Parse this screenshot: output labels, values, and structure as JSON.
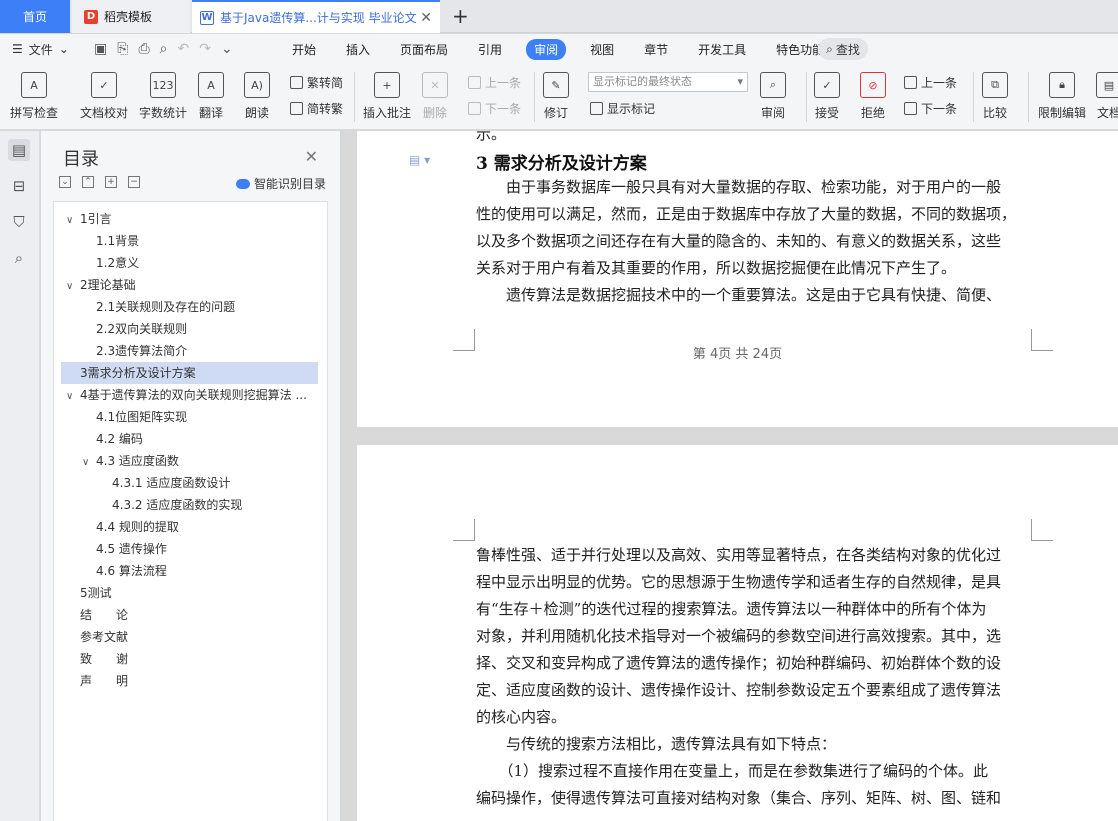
{
  "tabs": {
    "home": "首页",
    "template": "稻壳模板",
    "doc": "基于Java遗传算...计与实现 毕业论文"
  },
  "menu": {
    "file": "文件",
    "items": [
      "开始",
      "插入",
      "页面布局",
      "引用",
      "审阅",
      "视图",
      "章节",
      "开发工具",
      "特色功能"
    ],
    "active": "审阅",
    "find": "查找"
  },
  "ribbon": {
    "spellcheck": "拼写检查",
    "doc_proof": "文档校对",
    "word_count": "字数统计",
    "translate": "翻译",
    "read_aloud": "朗读",
    "to_traditional": "繁转简",
    "to_simplified": "简转繁",
    "insert_comment": "插入批注",
    "delete": "删除",
    "prev": "上一条",
    "next": "下一条",
    "revise": "修订",
    "markup_select": "显示标记的最终状态",
    "show_markup": "显示标记",
    "review": "审阅",
    "accept": "接受",
    "reject": "拒绝",
    "prev2": "上一条",
    "next2": "下一条",
    "compare": "比较",
    "restrict_edit": "限制编辑",
    "doc_right": "文档"
  },
  "toc": {
    "title": "目录",
    "smart": "智能识别目录",
    "items": [
      {
        "label": "1引言",
        "chev": "∨"
      },
      {
        "label": "1.1背景",
        "chev": ""
      },
      {
        "label": "1.2意义",
        "chev": ""
      },
      {
        "label": "2理论基础",
        "chev": "∨"
      },
      {
        "label": "2.1关联规则及存在的问题",
        "chev": ""
      },
      {
        "label": "2.2双向关联规则",
        "chev": ""
      },
      {
        "label": "2.3遗传算法简介",
        "chev": ""
      },
      {
        "label": "3需求分析及设计方案",
        "chev": ""
      },
      {
        "label": "4基于遗传算法的双向关联规则挖掘算法 ...",
        "chev": "∨"
      },
      {
        "label": "4.1位图矩阵实现",
        "chev": ""
      },
      {
        "label": "4.2 编码",
        "chev": ""
      },
      {
        "label": "4.3 适应度函数",
        "chev": "∨"
      },
      {
        "label": "4.3.1 适应度函数设计",
        "chev": ""
      },
      {
        "label": "4.3.2 适应度函数的实现",
        "chev": ""
      },
      {
        "label": "4.4 规则的提取",
        "chev": ""
      },
      {
        "label": "4.5 遗传操作",
        "chev": ""
      },
      {
        "label": "4.6 算法流程",
        "chev": ""
      },
      {
        "label": "5测试",
        "chev": ""
      },
      {
        "label": "结　　论",
        "chev": ""
      },
      {
        "label": "参考文献",
        "chev": ""
      },
      {
        "label": "致　　谢",
        "chev": ""
      },
      {
        "label": "声　　明",
        "chev": ""
      }
    ],
    "selected_index": 7
  },
  "doc": {
    "top_fragment": "示。",
    "heading": "3   需求分析及设计方案",
    "page1_lines": [
      "　　由于事务数据库一般只具有对大量数据的存取、检索功能，对于用户的一般",
      "性的使用可以满足，然而，正是由于数据库中存放了大量的数据，不同的数据项，",
      "以及多个数据项之间还存在有大量的隐含的、未知的、有意义的数据关系，这些",
      "关系对于用户有着及其重要的作用，所以数据挖掘便在此情况下产生了。",
      "　　遗传算法是数据挖掘技术中的一个重要算法。这是由于它具有快捷、简便、"
    ],
    "page_number": "第 4页  共 24页",
    "page2_lines": [
      "鲁棒性强、适于并行处理以及高效、实用等显著特点，在各类结构对象的优化过",
      "程中显示出明显的优势。它的思想源于生物遗传学和适者生存的自然规律，是具",
      "有“生存＋检测”的迭代过程的搜索算法。遗传算法以一种群体中的所有个体为",
      "对象，并利用随机化技术指导对一个被编码的参数空间进行高效搜索。其中，选",
      "择、交叉和变异构成了遗传算法的遗传操作；初始种群编码、初始群体个数的设",
      "定、适应度函数的设计、遗传操作设计、控制参数设定五个要素组成了遗传算法",
      "的核心内容。",
      "　　与传统的搜索方法相比，遗传算法具有如下特点：",
      "　　（1）搜索过程不直接作用在变量上，而是在参数集进行了编码的个体。此",
      "编码操作，使得遗传算法可直接对结构对象（集合、序列、矩阵、树、图、链和"
    ]
  }
}
